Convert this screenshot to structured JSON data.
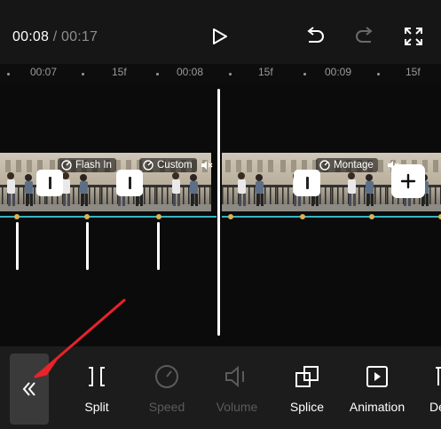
{
  "player": {
    "current_time": "00:08",
    "separator": "/",
    "total_time": "00:17",
    "icons": [
      "play-icon",
      "undo-icon",
      "redo-icon",
      "fullscreen-icon"
    ]
  },
  "ruler": {
    "ticks": [
      "00:07",
      "15f",
      "00:08",
      "15f",
      "00:09",
      "15f"
    ]
  },
  "clips": {
    "tags": [
      {
        "label": "Flash In",
        "icon": "transition-circle-icon"
      },
      {
        "label": "Custom",
        "icon": "transition-circle-icon"
      },
      {
        "label": "Montage",
        "icon": "transition-circle-icon"
      }
    ],
    "add_button": "+"
  },
  "toolbar": {
    "collapse_icon": "double-chevron-left-icon",
    "tools": [
      {
        "label": "Split",
        "enabled": true,
        "icon": "split-icon"
      },
      {
        "label": "Speed",
        "enabled": false,
        "icon": "speed-icon"
      },
      {
        "label": "Volume",
        "enabled": false,
        "icon": "volume-icon"
      },
      {
        "label": "Splice",
        "enabled": true,
        "icon": "splice-icon"
      },
      {
        "label": "Animation",
        "enabled": true,
        "icon": "animation-icon"
      },
      {
        "label": "De",
        "enabled": true,
        "icon": "delete-icon"
      }
    ]
  },
  "colors": {
    "accent_line": "#36b5c3",
    "keyframe": "#d8b357",
    "annotation_arrow": "#e8232a",
    "background": "#0d0d0d",
    "toolbar": "#1c1c1c"
  }
}
